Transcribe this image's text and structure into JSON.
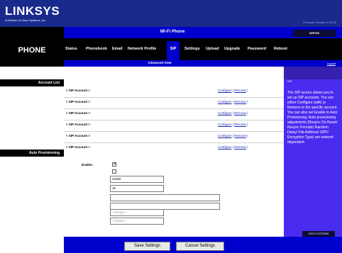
{
  "header": {
    "brand": "LINKSYS",
    "tagline": "A Division of Cisco Systems, Inc.",
    "firmware": "Firmware Version: 0.93.00",
    "page_title": "Wi-Fi Phone",
    "model": "WIP300",
    "section": "PHONE"
  },
  "tabs": [
    "Status",
    "Phonebook",
    "Email",
    "Network Profile",
    "SIP",
    "Settings",
    "Upload",
    "Upgrade",
    "Password",
    "Reboot"
  ],
  "active_tab": "SIP",
  "subbar": {
    "label": "Advanced View",
    "logout": "Logout"
  },
  "left": {
    "account_list": "Account List",
    "auto_provisioning": "Auto Provisioning"
  },
  "accounts": [
    {
      "name": "< SIP Account >",
      "configure": "Configure",
      "remove": "Remove"
    },
    {
      "name": "< SIP Account >",
      "configure": "Configure",
      "remove": "Remove"
    },
    {
      "name": "< SIP Account >",
      "configure": "Configure",
      "remove": "Remove"
    },
    {
      "name": "< SIP Account >",
      "configure": "Configure",
      "remove": "Remove"
    },
    {
      "name": "< SIP Account >",
      "configure": "Configure",
      "remove": "Remove"
    },
    {
      "name": "< SIP Account >",
      "configure": "Configure",
      "remove": "Remove"
    }
  ],
  "provisioning": {
    "enable_label": "Enable:",
    "enable_checked": true,
    "second_checked": false,
    "field1": "43200",
    "field2": "15",
    "field3": "",
    "field4": "",
    "field5_placeholder": "< Empty >",
    "field6_placeholder": "< Empty >"
  },
  "help": {
    "title": "SIP",
    "text": "The SIP screen allows you to set up SIP accounts. You can either Configure (edit) or Remove to the specific account. You can also set Enable to Auto Provisioning. Auto provisioning adjustments (Resync On Reset/ Resync Periodic/ Random Delay/ File Address/ OPP/ Encryption Type) are network dependent."
  },
  "cisco_label": "CISCO SYSTEMS",
  "buttons": {
    "save": "Save Settings",
    "cancel": "Cancel Settings"
  },
  "colors": {
    "dark_blue": "#1a2a8c",
    "bright_blue": "#0000cc",
    "help_panel": "#4a2cf0",
    "black": "#000000"
  }
}
